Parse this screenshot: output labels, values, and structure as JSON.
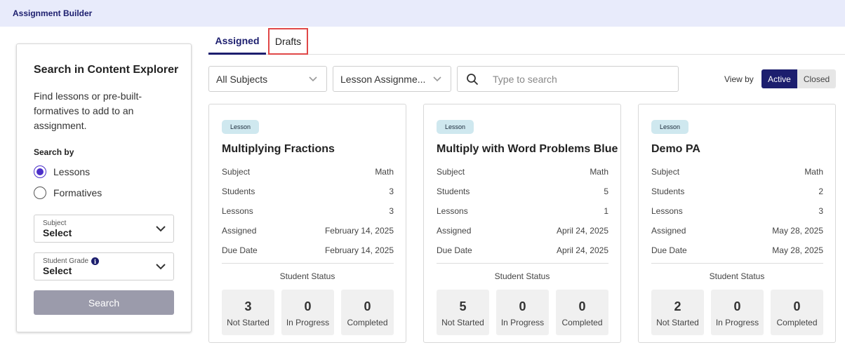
{
  "header": {
    "title": "Assignment Builder"
  },
  "search_panel": {
    "heading": "Search in Content Explorer",
    "description": "Find lessons or pre-built-formatives to add to an assignment.",
    "search_by_label": "Search by",
    "options": [
      {
        "label": "Lessons",
        "selected": true
      },
      {
        "label": "Formatives",
        "selected": false
      }
    ],
    "subject": {
      "label": "Subject",
      "value": "Select"
    },
    "grade": {
      "label": "Student Grade",
      "value": "Select"
    },
    "search_button": "Search"
  },
  "tabs": [
    {
      "label": "Assigned",
      "active": true
    },
    {
      "label": "Drafts",
      "active": false
    }
  ],
  "filters": {
    "subject_value": "All Subjects",
    "type_value": "Lesson Assignme...",
    "search_placeholder": "Type to search",
    "view_by_label": "View by",
    "active_label": "Active",
    "closed_label": "Closed"
  },
  "field_labels": {
    "subject": "Subject",
    "students": "Students",
    "lessons": "Lessons",
    "assigned": "Assigned",
    "due_date": "Due Date",
    "student_status": "Student Status",
    "not_started": "Not Started",
    "in_progress": "In Progress",
    "completed": "Completed"
  },
  "cards": [
    {
      "badge": "Lesson",
      "title": "Multiplying Fractions",
      "subject": "Math",
      "students": "3",
      "lessons": "3",
      "assigned": "February 14, 2025",
      "due_date": "February 14, 2025",
      "not_started": "3",
      "in_progress": "0",
      "completed": "0"
    },
    {
      "badge": "Lesson",
      "title": "Multiply with Word Problems Blue",
      "subject": "Math",
      "students": "5",
      "lessons": "1",
      "assigned": "April 24, 2025",
      "due_date": "April 24, 2025",
      "not_started": "5",
      "in_progress": "0",
      "completed": "0"
    },
    {
      "badge": "Lesson",
      "title": "Demo PA",
      "subject": "Math",
      "students": "2",
      "lessons": "3",
      "assigned": "May 28, 2025",
      "due_date": "May 28, 2025",
      "not_started": "2",
      "in_progress": "0",
      "completed": "0"
    }
  ],
  "colors": {
    "brand": "#1c1e6e",
    "radio_selected": "#4b2fc9",
    "drafts_highlight": "#e04848",
    "badge_bg": "#cfe8ef",
    "button_disabled": "#9b9bab"
  }
}
